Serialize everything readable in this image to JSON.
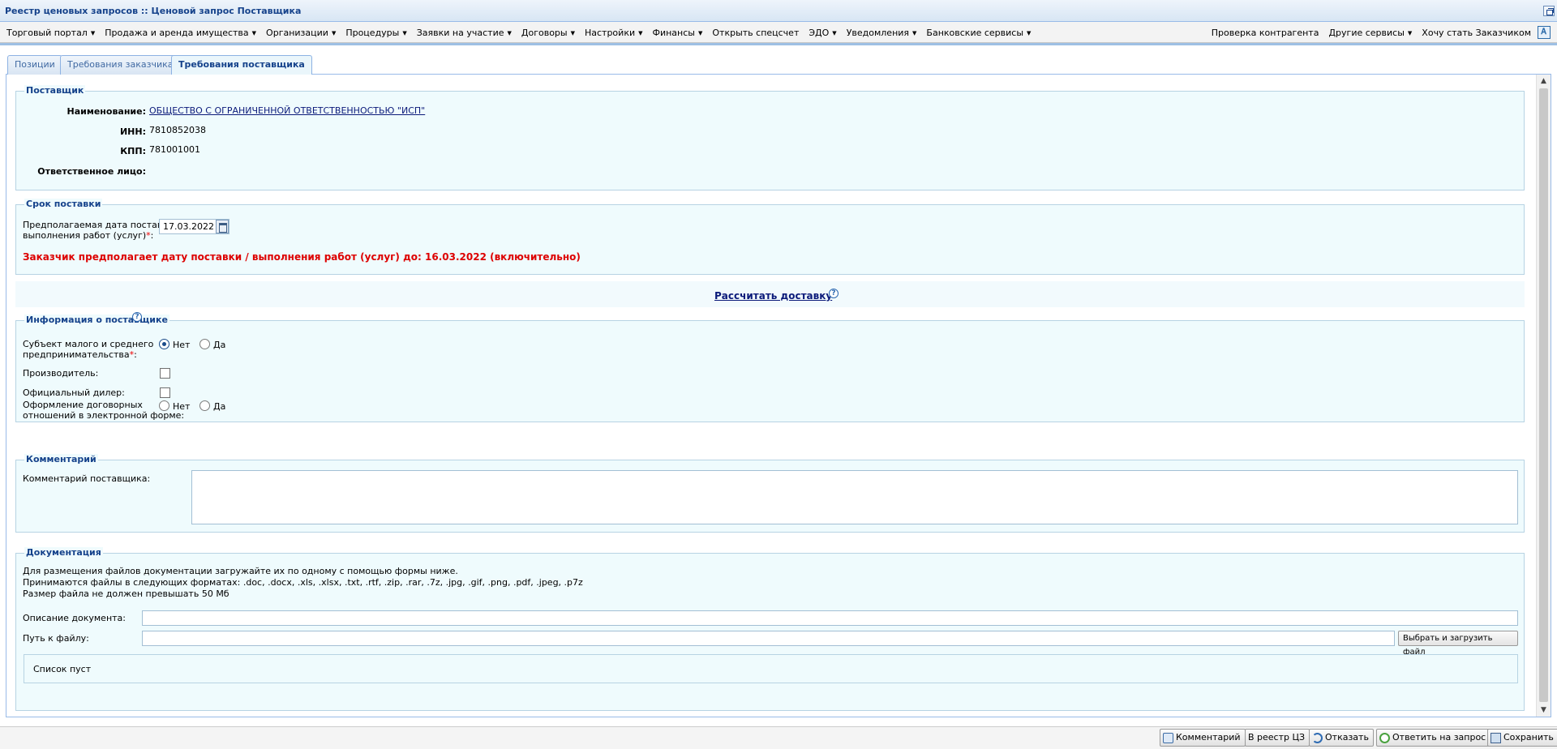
{
  "window": {
    "title": "Реестр ценовых запросов :: Ценовой запрос Поставщика"
  },
  "menu": {
    "left": [
      {
        "label": "Торговый портал",
        "dropdown": true
      },
      {
        "label": "Продажа и аренда имущества",
        "dropdown": true
      },
      {
        "label": "Организации",
        "dropdown": true
      },
      {
        "label": "Процедуры",
        "dropdown": true
      },
      {
        "label": "Заявки на участие",
        "dropdown": true
      },
      {
        "label": "Договоры",
        "dropdown": true
      },
      {
        "label": "Настройки",
        "dropdown": true
      },
      {
        "label": "Финансы",
        "dropdown": true
      },
      {
        "label": "Открыть спецсчет",
        "dropdown": false
      },
      {
        "label": "ЭДО",
        "dropdown": true
      },
      {
        "label": "Уведомления",
        "dropdown": true
      },
      {
        "label": "Банковские сервисы",
        "dropdown": true
      }
    ],
    "right": [
      {
        "label": "Проверка контрагента",
        "dropdown": false
      },
      {
        "label": "Другие сервисы",
        "dropdown": true
      },
      {
        "label": "Хочу стать Заказчиком",
        "dropdown": false
      }
    ]
  },
  "tabs": [
    {
      "label": "Позиции",
      "active": false
    },
    {
      "label": "Требования заказчика",
      "active": false
    },
    {
      "label": "Требования поставщика",
      "active": true
    }
  ],
  "supplier": {
    "legend": "Поставщик",
    "name_label": "Наименование:",
    "name_value": "ОБЩЕСТВО С ОГРАНИЧЕННОЙ ОТВЕТСТВЕННОСТЬЮ \"ИСП\"",
    "inn_label": "ИНН:",
    "inn_value": "7810852038",
    "kpp_label": "КПП:",
    "kpp_value": "781001001",
    "resp_label": "Ответственное лицо:"
  },
  "delivery": {
    "legend": "Срок поставки",
    "date_label_1": "Предполагаемая дата поставки /",
    "date_label_2": "выполнения работ (услуг)",
    "date_label_3": ":",
    "date_value": "17.03.2022",
    "warning": "Заказчик предполагает дату поставки / выполнения работ (услуг) до: 16.03.2022 (включительно)",
    "calc_link": "Рассчитать доставку"
  },
  "supplier_info": {
    "legend": "Информация о поставщике",
    "sme_label_1": "Субъект малого и среднего",
    "sme_label_2": "предпринимательства",
    "sme_label_3": ":",
    "no": "Нет",
    "yes": "Да",
    "sme_selected": "Нет",
    "manufacturer_label": "Производитель:",
    "dealer_label": "Официальный дилер:",
    "electronic_label_1": "Оформление договорных",
    "electronic_label_2": "отношений в электронной форме:"
  },
  "comment": {
    "legend": "Комментарий",
    "label": "Комментарий поставщика:"
  },
  "docs": {
    "legend": "Документация",
    "info_1": "Для размещения файлов документации загружайте их по одному с помощью формы ниже.",
    "info_2": "Принимаются файлы в следующих форматах: .doc, .docx, .xls, .xlsx, .txt, .rtf, .zip, .rar, .7z, .jpg, .gif, .png, .pdf, .jpeg, .p7z",
    "info_3": "Размер файла не должен превышать 50 Мб",
    "desc_label": "Описание документа:",
    "path_label": "Путь к файлу:",
    "upload_button": "Выбрать и загрузить файл",
    "empty_list": "Список пуст"
  },
  "footer": {
    "comment": "Комментарий",
    "registry": "В реестр ЦЗ",
    "refuse": "Отказать",
    "answer": "Ответить на запрос",
    "save": "Сохранить"
  },
  "colors": {
    "accent": "#15428b",
    "warning": "#dd0000",
    "panel_bg": "#effbfd",
    "border": "#99bbe8"
  }
}
